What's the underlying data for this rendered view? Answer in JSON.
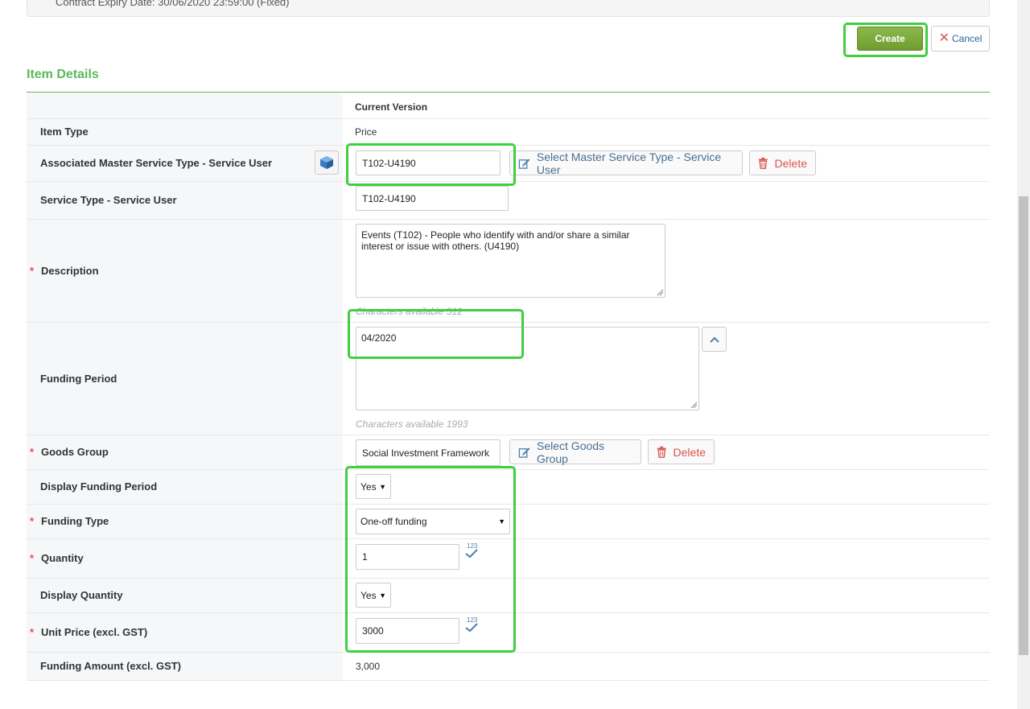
{
  "top_panel": {
    "expiry_text": "Contract Expiry Date: 30/06/2020 23:59:00 (Fixed)"
  },
  "actions": {
    "create_label": "Create",
    "cancel_label": "Cancel"
  },
  "section": {
    "title": "Item Details",
    "column_header": "Current Version"
  },
  "rows": {
    "item_type": {
      "label": "Item Type",
      "value": "Price"
    },
    "master_service": {
      "label": "Associated Master Service Type - Service User",
      "value": "T102-U4190",
      "select_label": "Select Master Service Type - Service User",
      "delete_label": "Delete"
    },
    "service_type": {
      "label": "Service Type - Service User",
      "value": "T102-U4190"
    },
    "description": {
      "label": "Description",
      "value": "Events (T102) - People who identify with and/or share a similar interest or issue with others. (U4190)",
      "hint": "Characters available 512"
    },
    "funding_period": {
      "label": "Funding Period",
      "value": "04/2020",
      "hint": "Characters available 1993"
    },
    "goods_group": {
      "label": "Goods Group",
      "value": "Social Investment Framework",
      "select_label": "Select Goods Group",
      "delete_label": "Delete"
    },
    "display_funding_period": {
      "label": "Display Funding Period",
      "value": "Yes"
    },
    "funding_type": {
      "label": "Funding Type",
      "value": "One-off funding"
    },
    "quantity": {
      "label": "Quantity",
      "value": "1"
    },
    "display_quantity": {
      "label": "Display Quantity",
      "value": "Yes"
    },
    "unit_price": {
      "label": "Unit Price (excl. GST)",
      "value": "3000"
    },
    "funding_amount": {
      "label": "Funding Amount (excl. GST)",
      "value": "3,000"
    }
  },
  "required_marker": "*",
  "num_badge_text": "123",
  "colors": {
    "accent_green": "#5cb85c",
    "highlight": "#3fcf3f",
    "danger": "#d9534f",
    "link": "#4a6e8f"
  }
}
